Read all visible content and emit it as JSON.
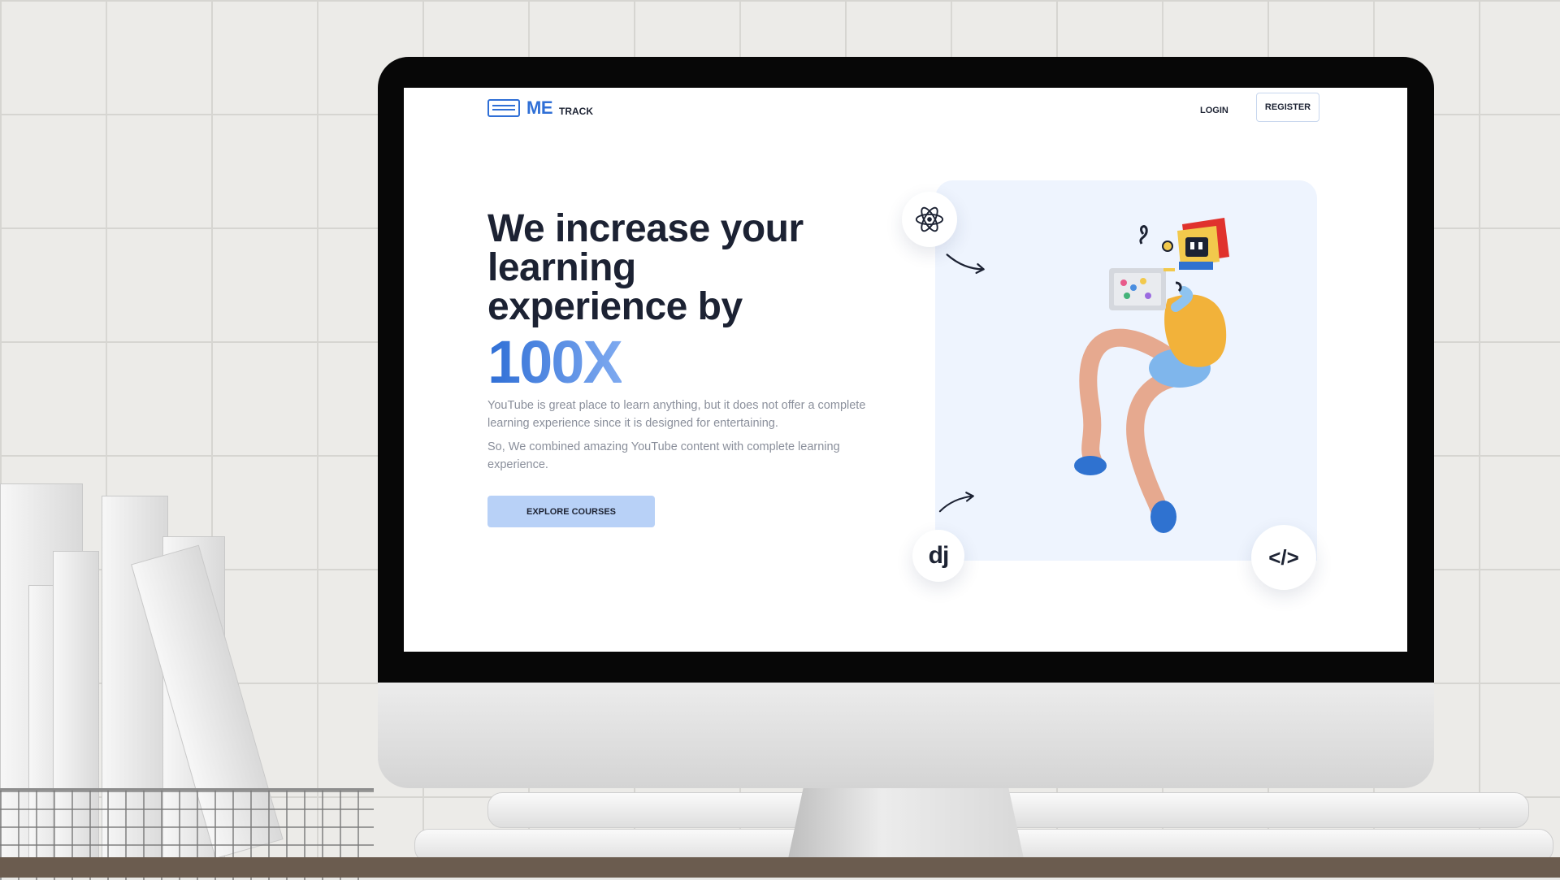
{
  "site": {
    "logo": {
      "me": "ME",
      "track": "TRACK",
      "icon": "code-window-icon"
    },
    "nav": {
      "login": "LOGIN",
      "register": "REGISTER"
    },
    "hero": {
      "headline": "We increase your learning experience by",
      "highlight": "100X",
      "paragraph_1": "YouTube is great place to learn anything, but it does not offer a complete learning experience since it is designed for entertaining.",
      "paragraph_2": "So, We combined amazing YouTube content with complete learning experience.",
      "cta": "EXPLORE COURSES"
    },
    "badges": {
      "react_icon": "react-atom-icon",
      "django_label": "dj",
      "code_label": "</>"
    }
  },
  "colors": {
    "brand_blue": "#2f6fd6",
    "heading_dark": "#1c2233",
    "muted_text": "#8a8f9b",
    "cta_bg": "#b8d1f7",
    "panel_bg": "#eef4fe"
  }
}
